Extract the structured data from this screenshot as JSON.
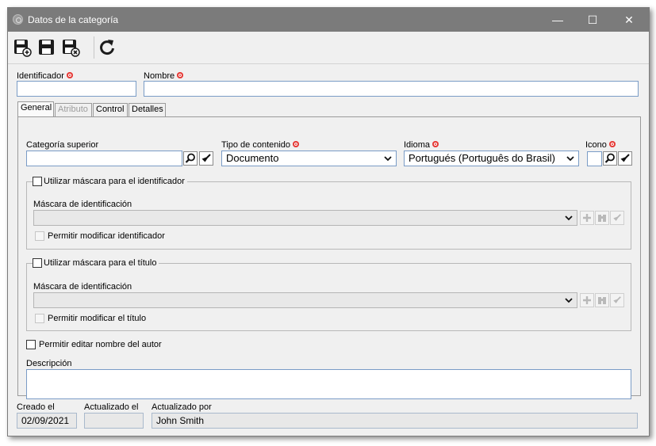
{
  "window": {
    "title": "Datos de la categoría",
    "minimize_glyph": "—",
    "maximize_glyph": "☐",
    "close_glyph": "✕"
  },
  "toolbar": {
    "buttons": [
      {
        "name": "save-new-icon"
      },
      {
        "name": "save-icon"
      },
      {
        "name": "save-close-icon"
      },
      {
        "name": "refresh-icon"
      }
    ]
  },
  "header": {
    "identifier_label": "Identificador",
    "identifier_value": "",
    "name_label": "Nombre",
    "name_value": ""
  },
  "tabs": [
    {
      "label": "General",
      "active": true
    },
    {
      "label": "Atributo",
      "disabled": true
    },
    {
      "label": "Control"
    },
    {
      "label": "Detalles"
    }
  ],
  "general": {
    "parent_category_label": "Categoría superior",
    "parent_category_value": "",
    "content_type_label": "Tipo de contenido",
    "content_type_value": "Documento",
    "language_label": "Idioma",
    "language_value": "Portugués (Português do Brasil)",
    "icon_label": "Icono",
    "id_mask_group": {
      "checkbox_label": "Utilizar máscara para el identificador",
      "mask_label": "Máscara de identificación",
      "mask_value": "",
      "allow_label": "Permitir modificar identificador"
    },
    "title_mask_group": {
      "checkbox_label": "Utilizar máscara para el título",
      "mask_label": "Máscara de identificación",
      "mask_value": "",
      "allow_label": "Permitir modificar el título"
    },
    "edit_author_label": "Permitir editar nombre del autor",
    "description_label": "Descripción",
    "description_value": ""
  },
  "footer": {
    "created_label": "Creado el",
    "created_value": "02/09/2021",
    "updated_label": "Actualizado el",
    "updated_value": "",
    "updated_by_label": "Actualizado por",
    "updated_by_value": "John Smith"
  },
  "colors": {
    "titlebar": "#7b7b7b",
    "required": "#e53935",
    "input_border": "#7a9cc6"
  }
}
